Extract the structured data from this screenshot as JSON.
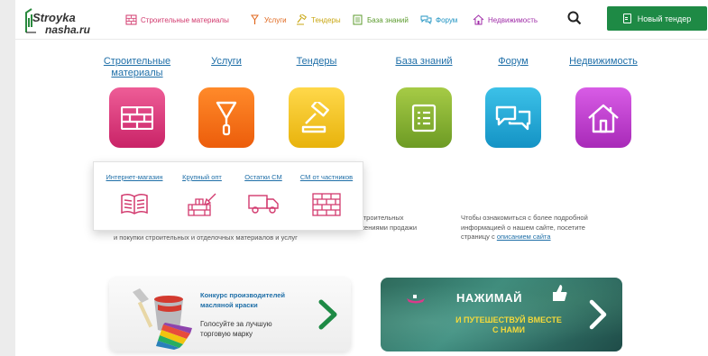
{
  "header": {
    "logo_line1": "Stroyka",
    "logo_line2": "nasha.ru",
    "nav": [
      {
        "label": "Строительные материалы",
        "icon": "bricks-icon",
        "color": "#d23a6e"
      },
      {
        "label": "Услуги",
        "icon": "trowel-icon",
        "color": "#e0671d"
      },
      {
        "label": "Тендеры",
        "icon": "gavel-icon",
        "color": "#c9a713"
      },
      {
        "label": "База знаний",
        "icon": "checklist-icon",
        "color": "#5c9b2e"
      },
      {
        "label": "Форум",
        "icon": "chat-icon",
        "color": "#1f93c2"
      },
      {
        "label": "Недвижимость",
        "icon": "house-icon",
        "color": "#a02ea8"
      }
    ],
    "search_icon": "search-icon",
    "new_tender_label": "Новый тендер"
  },
  "categories": [
    {
      "label": "Строительные материалы",
      "icon": "bricks-icon",
      "color": "#d63478"
    },
    {
      "label": "Услуги",
      "icon": "trowel-icon",
      "color": "#f26f1b"
    },
    {
      "label": "Тендеры",
      "icon": "gavel-icon",
      "color": "#f2c41d"
    },
    {
      "label": "База знаний",
      "icon": "checklist-icon",
      "color": "#84b234"
    },
    {
      "label": "Форум",
      "icon": "chat-icon",
      "color": "#25a9d8"
    },
    {
      "label": "Недвижимость",
      "icon": "house-icon",
      "color": "#c143cf"
    }
  ],
  "dropdown": {
    "items": [
      {
        "label": "Интернет-магазин",
        "icon": "book-icon"
      },
      {
        "label": "Крупный опт",
        "icon": "brick-wall-trowel-icon"
      },
      {
        "label": "Остатки СМ",
        "icon": "truck-icon"
      },
      {
        "label": "СМ от частников",
        "icon": "brick-wall-icon"
      }
    ]
  },
  "info": {
    "left_fragment_1": "строительных",
    "left_fragment_2": "жениями продажи",
    "left_line_3": "и покупки строительных и отделочных материалов и услуг",
    "right_line_1": "Чтобы ознакомиться с более подробной",
    "right_line_2": "информацией о нашем сайте, посетите",
    "right_line_3_prefix": "страницу с ",
    "right_link": "описанием сайта"
  },
  "banners": {
    "paint": {
      "title": "Конкурс производителей масляной краски",
      "subtitle": "Голосуйте за лучшую торговую марку"
    },
    "travel": {
      "headline": "НАЖИМАЙ",
      "subline": "И ПУТЕШЕСТВУЙ ВМЕСТЕ С НАМИ"
    }
  }
}
